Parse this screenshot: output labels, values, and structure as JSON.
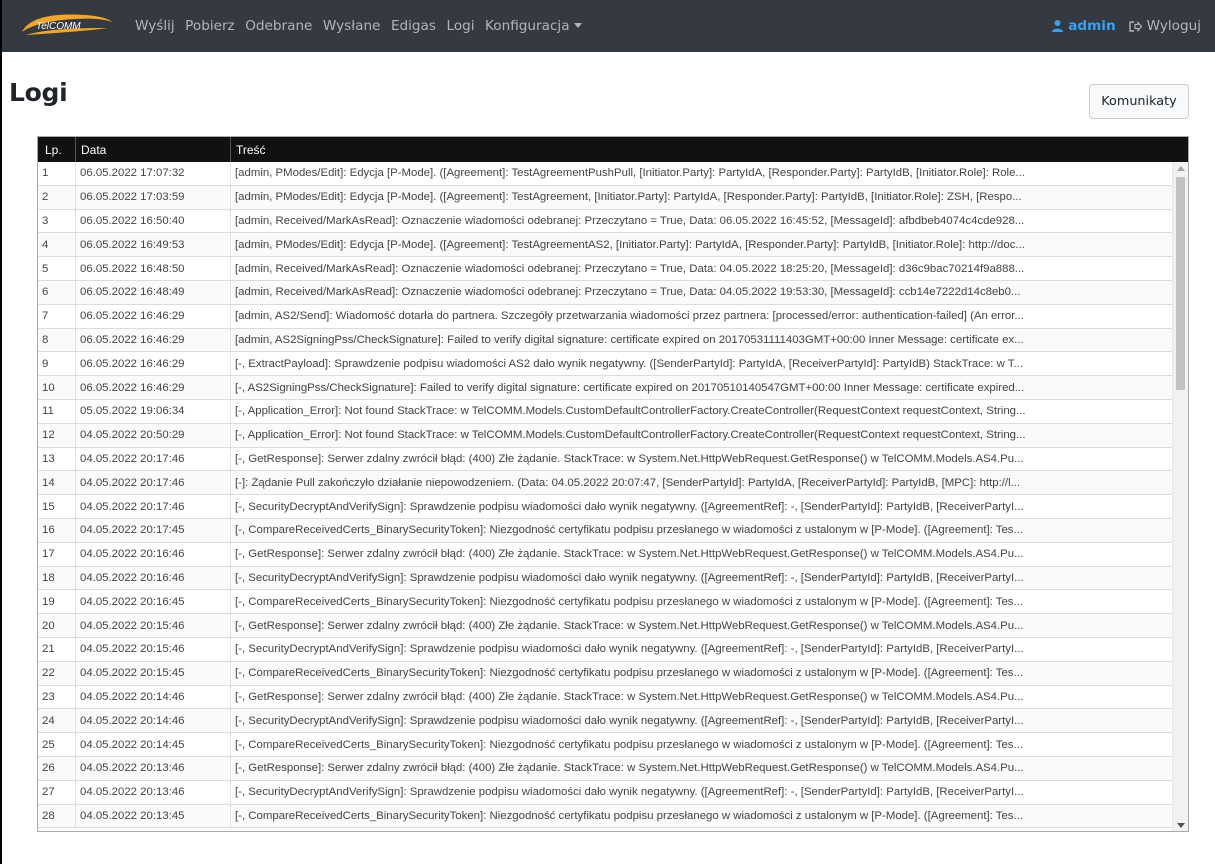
{
  "navbar": {
    "logo_text": "TelCOMM",
    "items": [
      {
        "label": "Wyślij"
      },
      {
        "label": "Pobierz"
      },
      {
        "label": "Odebrane"
      },
      {
        "label": "Wysłane"
      },
      {
        "label": "Edigas"
      },
      {
        "label": "Logi"
      },
      {
        "label": "Konfiguracja"
      }
    ],
    "user": "admin",
    "logout": "Wyloguj"
  },
  "page": {
    "title": "Logi",
    "messages_button": "Komunikaty"
  },
  "table": {
    "columns": [
      "Lp.",
      "Data",
      "Treść"
    ],
    "rows": [
      [
        "1",
        "06.05.2022 17:07:32",
        "[admin, PModes/Edit]: Edycja [P-Mode]. ([Agreement]: TestAgreementPushPull, [Initiator.Party]: PartyIdA, [Responder.Party]: PartyIdB, [Initiator.Role]: Role..."
      ],
      [
        "2",
        "06.05.2022 17:03:59",
        "[admin, PModes/Edit]: Edycja [P-Mode]. ([Agreement]: TestAgreement, [Initiator.Party]: PartyIdA, [Responder.Party]: PartyIdB, [Initiator.Role]: ZSH, [Respo..."
      ],
      [
        "3",
        "06.05.2022 16:50:40",
        "[admin, Received/MarkAsRead]: Oznaczenie wiadomości odebranej: Przeczytano = True, Data: 06.05.2022 16:45:52, [MessageId]: afbdbeb4074c4cde928..."
      ],
      [
        "4",
        "06.05.2022 16:49:53",
        "[admin, PModes/Edit]: Edycja [P-Mode]. ([Agreement]: TestAgreementAS2, [Initiator.Party]: PartyIdA, [Responder.Party]: PartyIdB, [Initiator.Role]: http://doc..."
      ],
      [
        "5",
        "06.05.2022 16:48:50",
        "[admin, Received/MarkAsRead]: Oznaczenie wiadomości odebranej: Przeczytano = True, Data: 04.05.2022 18:25:20, [MessageId]: d36c9bac70214f9a888..."
      ],
      [
        "6",
        "06.05.2022 16:48:49",
        "[admin, Received/MarkAsRead]: Oznaczenie wiadomości odebranej: Przeczytano = True, Data: 04.05.2022 19:53:30, [MessageId]: ccb14e7222d14c8eb0..."
      ],
      [
        "7",
        "06.05.2022 16:46:29",
        "[admin, AS2/Send]: Wiadomość dotarła do partnera. Szczegóły przetwarzania wiadomości przez partnera: [processed/error: authentication-failed] (An error..."
      ],
      [
        "8",
        "06.05.2022 16:46:29",
        "[admin, AS2SigningPss/CheckSignature]: Failed to verify digital signature: certificate expired on 20170531111403GMT+00:00 Inner Message: certificate ex..."
      ],
      [
        "9",
        "06.05.2022 16:46:29",
        "[-, ExtractPayload]: Sprawdzenie podpisu wiadomości AS2 dało wynik negatywny. ([SenderPartyId]: PartyIdA, [ReceiverPartyId]: PartyIdB) StackTrace: w T..."
      ],
      [
        "10",
        "06.05.2022 16:46:29",
        "[-, AS2SigningPss/CheckSignature]: Failed to verify digital signature: certificate expired on 20170510140547GMT+00:00 Inner Message: certificate expired..."
      ],
      [
        "11",
        "05.05.2022 19:06:34",
        "[-, Application_Error]: Not found StackTrace: w TelCOMM.Models.CustomDefaultControllerFactory.CreateController(RequestContext requestContext, String..."
      ],
      [
        "12",
        "04.05.2022 20:50:29",
        "[-, Application_Error]: Not found StackTrace: w TelCOMM.Models.CustomDefaultControllerFactory.CreateController(RequestContext requestContext, String..."
      ],
      [
        "13",
        "04.05.2022 20:17:46",
        "[-, GetResponse]: Serwer zdalny zwrócił błąd: (400) Złe żądanie. StackTrace: w System.Net.HttpWebRequest.GetResponse() w TelCOMM.Models.AS4.Pu..."
      ],
      [
        "14",
        "04.05.2022 20:17:46",
        "[-]: Żądanie Pull zakończyło działanie niepowodzeniem. (Data: 04.05.2022 20:07:47, [SenderPartyId]: PartyIdA, [ReceiverPartyId]: PartyIdB, [MPC]: http://l..."
      ],
      [
        "15",
        "04.05.2022 20:17:46",
        "[-, SecurityDecryptAndVerifySign]: Sprawdzenie podpisu wiadomości dało wynik negatywny. ([AgreementRef]: -, [SenderPartyId]: PartyIdB, [ReceiverPartyI..."
      ],
      [
        "16",
        "04.05.2022 20:17:45",
        "[-, CompareReceivedCerts_BinarySecurityToken]: Niezgodność certyfikatu podpisu przesłanego w wiadomości z ustalonym w [P-Mode]. ([Agreement]: Tes..."
      ],
      [
        "17",
        "04.05.2022 20:16:46",
        "[-, GetResponse]: Serwer zdalny zwrócił błąd: (400) Złe żądanie. StackTrace: w System.Net.HttpWebRequest.GetResponse() w TelCOMM.Models.AS4.Pu..."
      ],
      [
        "18",
        "04.05.2022 20:16:46",
        "[-, SecurityDecryptAndVerifySign]: Sprawdzenie podpisu wiadomości dało wynik negatywny. ([AgreementRef]: -, [SenderPartyId]: PartyIdB, [ReceiverPartyI..."
      ],
      [
        "19",
        "04.05.2022 20:16:45",
        "[-, CompareReceivedCerts_BinarySecurityToken]: Niezgodność certyfikatu podpisu przesłanego w wiadomości z ustalonym w [P-Mode]. ([Agreement]: Tes..."
      ],
      [
        "20",
        "04.05.2022 20:15:46",
        "[-, GetResponse]: Serwer zdalny zwrócił błąd: (400) Złe żądanie. StackTrace: w System.Net.HttpWebRequest.GetResponse() w TelCOMM.Models.AS4.Pu..."
      ],
      [
        "21",
        "04.05.2022 20:15:46",
        "[-, SecurityDecryptAndVerifySign]: Sprawdzenie podpisu wiadomości dało wynik negatywny. ([AgreementRef]: -, [SenderPartyId]: PartyIdB, [ReceiverPartyI..."
      ],
      [
        "22",
        "04.05.2022 20:15:45",
        "[-, CompareReceivedCerts_BinarySecurityToken]: Niezgodność certyfikatu podpisu przesłanego w wiadomości z ustalonym w [P-Mode]. ([Agreement]: Tes..."
      ],
      [
        "23",
        "04.05.2022 20:14:46",
        "[-, GetResponse]: Serwer zdalny zwrócił błąd: (400) Złe żądanie. StackTrace: w System.Net.HttpWebRequest.GetResponse() w TelCOMM.Models.AS4.Pu..."
      ],
      [
        "24",
        "04.05.2022 20:14:46",
        "[-, SecurityDecryptAndVerifySign]: Sprawdzenie podpisu wiadomości dało wynik negatywny. ([AgreementRef]: -, [SenderPartyId]: PartyIdB, [ReceiverPartyI..."
      ],
      [
        "25",
        "04.05.2022 20:14:45",
        "[-, CompareReceivedCerts_BinarySecurityToken]: Niezgodność certyfikatu podpisu przesłanego w wiadomości z ustalonym w [P-Mode]. ([Agreement]: Tes..."
      ],
      [
        "26",
        "04.05.2022 20:13:46",
        "[-, GetResponse]: Serwer zdalny zwrócił błąd: (400) Złe żądanie. StackTrace: w System.Net.HttpWebRequest.GetResponse() w TelCOMM.Models.AS4.Pu..."
      ],
      [
        "27",
        "04.05.2022 20:13:46",
        "[-, SecurityDecryptAndVerifySign]: Sprawdzenie podpisu wiadomości dało wynik negatywny. ([AgreementRef]: -, [SenderPartyId]: PartyIdB, [ReceiverPartyI..."
      ],
      [
        "28",
        "04.05.2022 20:13:45",
        "[-, CompareReceivedCerts_BinarySecurityToken]: Niezgodność certyfikatu podpisu przesłanego w wiadomości z ustalonym w [P-Mode]. ([Agreement]: Tes..."
      ]
    ]
  },
  "icons": {
    "user": "user-icon",
    "logout": "sign-out-icon",
    "dropdown": "caret-down-icon"
  },
  "colors": {
    "navbar_bg": "#343a40",
    "user_accent": "#35a2f5",
    "table_header_bg": "#111111",
    "logo_orange": "#f5a623"
  }
}
